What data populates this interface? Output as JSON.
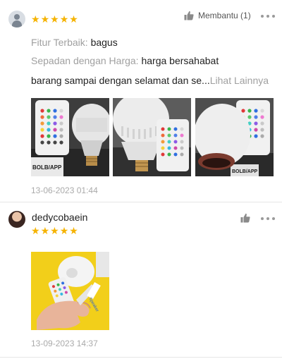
{
  "reviews": [
    {
      "stars": 5,
      "helpful_label": "Membantu (1)",
      "feature_label": "Fitur Terbaik:",
      "feature_value": "bagus",
      "price_label": "Sepadan dengan Harga:",
      "price_value": "harga bersahabat",
      "body": "barang sampai dengan selamat dan se...",
      "see_more": "Lihat Lainnya",
      "date": "13-06-2023 01:44"
    },
    {
      "username": "dedycobaein",
      "stars": 5,
      "date": "13-09-2023 14:37"
    }
  ],
  "icons": {
    "default_avatar": "user-icon",
    "thumbs_up": "thumbs-up-icon",
    "more": "more-horizontal-icon",
    "star": "star-icon"
  },
  "colors": {
    "star": "#f5b301",
    "muted_text": "#a0a0a0",
    "divider": "#e6e6e6"
  }
}
